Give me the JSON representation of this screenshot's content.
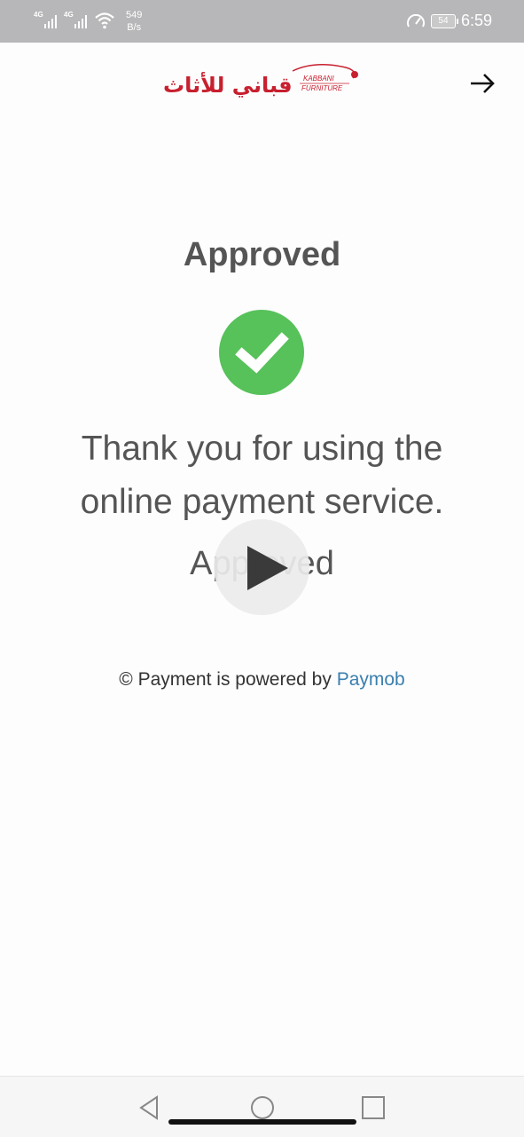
{
  "status_bar": {
    "network_1": "4G",
    "network_2": "4G",
    "speed_value": "549",
    "speed_unit": "B/s",
    "battery": "54",
    "time": "6:59"
  },
  "header": {
    "logo_text_arabic": "قباني للأثاث",
    "logo_text_english_1": "KABBANI",
    "logo_text_english_2": "FURNITURE",
    "icons": {
      "forward": "arrow-right-icon"
    }
  },
  "result": {
    "title": "Approved",
    "message": "Thank you for using the online payment service.",
    "status": "Approved"
  },
  "footer": {
    "powered_prefix": "© Payment is powered by ",
    "powered_link": "Paymob"
  },
  "colors": {
    "success": "#57c15a",
    "link": "#3a7fae",
    "brand": "#c8202f"
  }
}
